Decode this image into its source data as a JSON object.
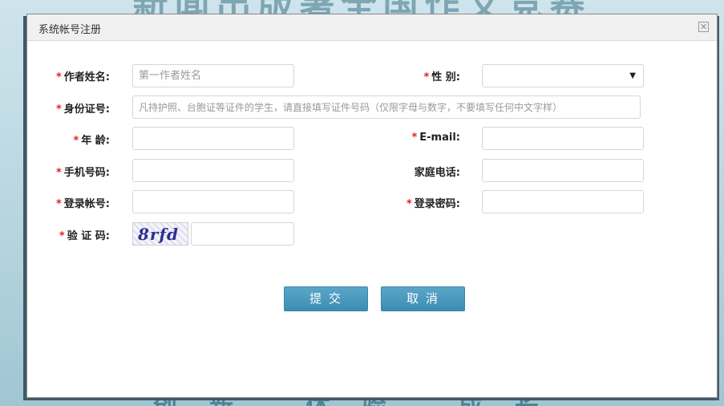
{
  "background": {
    "top_text": "新闻出版署全国作文竞赛",
    "bottom_text": "创新 体验 成长"
  },
  "dialog": {
    "title": "系统帐号注册",
    "close_icon": "close-icon"
  },
  "form": {
    "author_name": {
      "label": "作者姓名:",
      "placeholder": "第一作者姓名",
      "required": true
    },
    "gender": {
      "label": "性 别:",
      "value": "",
      "required": true
    },
    "id_number": {
      "label": "身份证号:",
      "placeholder": "凡持护照、台胞证等证件的学生，请直接填写证件号码（仅限字母与数字，不要填写任何中文字样）",
      "required": true
    },
    "age": {
      "label": "年 龄:",
      "value": "",
      "required": true
    },
    "email": {
      "label": "E-mail:",
      "value": "",
      "required": true
    },
    "mobile": {
      "label": "手机号码:",
      "value": "",
      "required": true
    },
    "home_phone": {
      "label": "家庭电话:",
      "value": "",
      "required": false
    },
    "login_account": {
      "label": "登录帐号:",
      "value": "",
      "required": true
    },
    "login_password": {
      "label": "登录密码:",
      "value": "",
      "required": true
    },
    "captcha": {
      "label": "验 证 码:",
      "image_text": "8rfd",
      "value": "",
      "required": true
    }
  },
  "buttons": {
    "submit": "提 交",
    "cancel": "取 消"
  },
  "required_mark": "*"
}
